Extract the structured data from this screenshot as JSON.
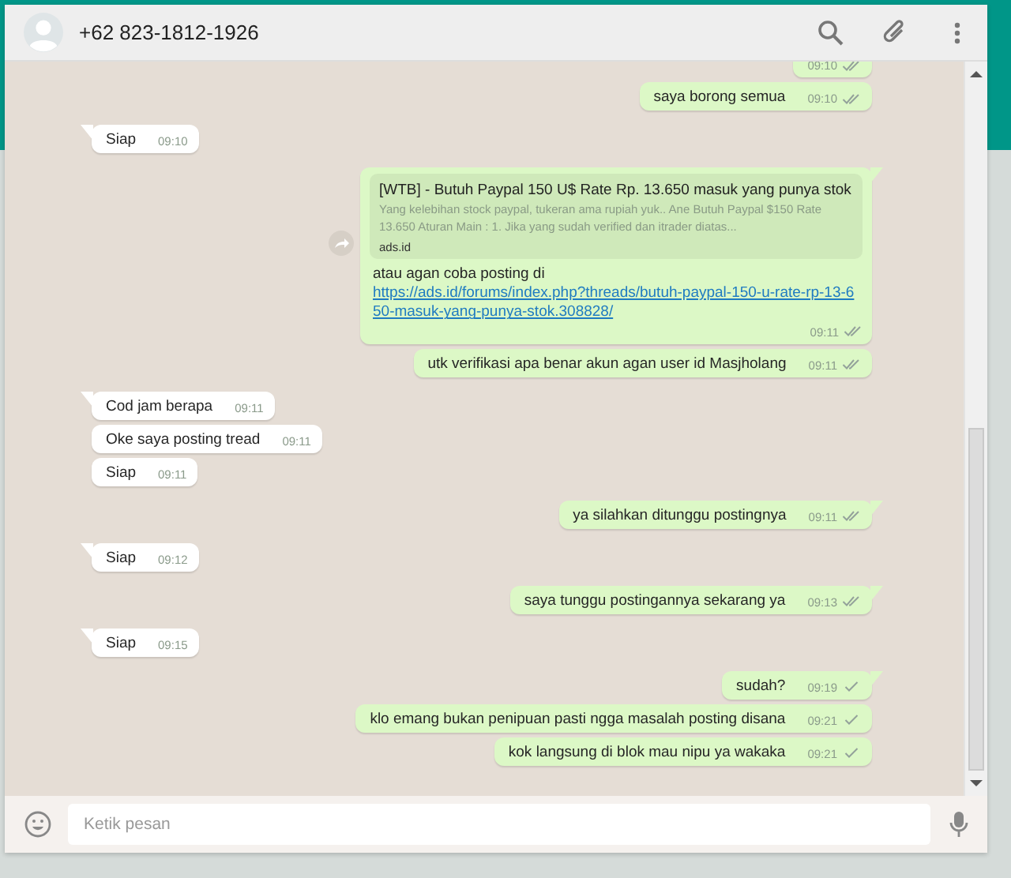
{
  "contact": {
    "name": "+62 823-1812-1926"
  },
  "messages": [
    {
      "kind": "text",
      "outgoing": true,
      "tail": false,
      "time": "09:10",
      "read": true
    },
    {
      "kind": "text",
      "outgoing": true,
      "tail": false,
      "text": "saya borong semua",
      "time": "09:10",
      "read": true
    },
    {
      "kind": "text",
      "outgoing": false,
      "tail": true,
      "text": "Siap",
      "time": "09:10"
    },
    {
      "kind": "link_preview",
      "outgoing": true,
      "tail": true,
      "preview": {
        "title": "[WTB] - Butuh Paypal 150 U$ Rate Rp. 13.650 masuk yang punya stok",
        "description": "Yang kelebihan stock paypal, tukeran ama rupiah yuk.. Ane Butuh Paypal $150 Rate 13.650 Aturan Main : 1. Jika yang sudah verified dan itrader diatas...",
        "domain": "ads.id"
      },
      "text": "atau agan coba posting di",
      "link": "https://ads.id/forums/index.php?threads/butuh-paypal-150-u-rate-rp-13-650-masuk-yang-punya-stok.308828/",
      "time": "09:11",
      "read": true
    },
    {
      "kind": "text",
      "outgoing": true,
      "tail": false,
      "text": "utk verifikasi apa benar akun agan user id Masjholang",
      "time": "09:11",
      "read": true
    },
    {
      "kind": "text",
      "outgoing": false,
      "tail": true,
      "text": "Cod jam berapa",
      "time": "09:11"
    },
    {
      "kind": "text",
      "outgoing": false,
      "tail": false,
      "text": "Oke saya posting tread",
      "time": "09:11"
    },
    {
      "kind": "text",
      "outgoing": false,
      "tail": false,
      "text": "Siap",
      "time": "09:11"
    },
    {
      "kind": "text",
      "outgoing": true,
      "tail": true,
      "text": "ya silahkan ditunggu postingnya",
      "time": "09:11",
      "read": true
    },
    {
      "kind": "text",
      "outgoing": false,
      "tail": true,
      "text": "Siap",
      "time": "09:12"
    },
    {
      "kind": "text",
      "outgoing": true,
      "tail": true,
      "text": "saya tunggu postingannya sekarang ya",
      "time": "09:13",
      "read": true
    },
    {
      "kind": "text",
      "outgoing": false,
      "tail": true,
      "text": "Siap",
      "time": "09:15"
    },
    {
      "kind": "text",
      "outgoing": true,
      "tail": true,
      "text": "sudah?",
      "time": "09:19",
      "read": false
    },
    {
      "kind": "text",
      "outgoing": true,
      "tail": false,
      "text": "klo emang bukan penipuan pasti ngga masalah posting disana",
      "time": "09:21",
      "read": false
    },
    {
      "kind": "text",
      "outgoing": true,
      "tail": false,
      "text": "kok langsung di blok mau nipu ya wakaka",
      "time": "09:21",
      "read": false
    }
  ],
  "composer": {
    "placeholder": "Ketik pesan"
  }
}
